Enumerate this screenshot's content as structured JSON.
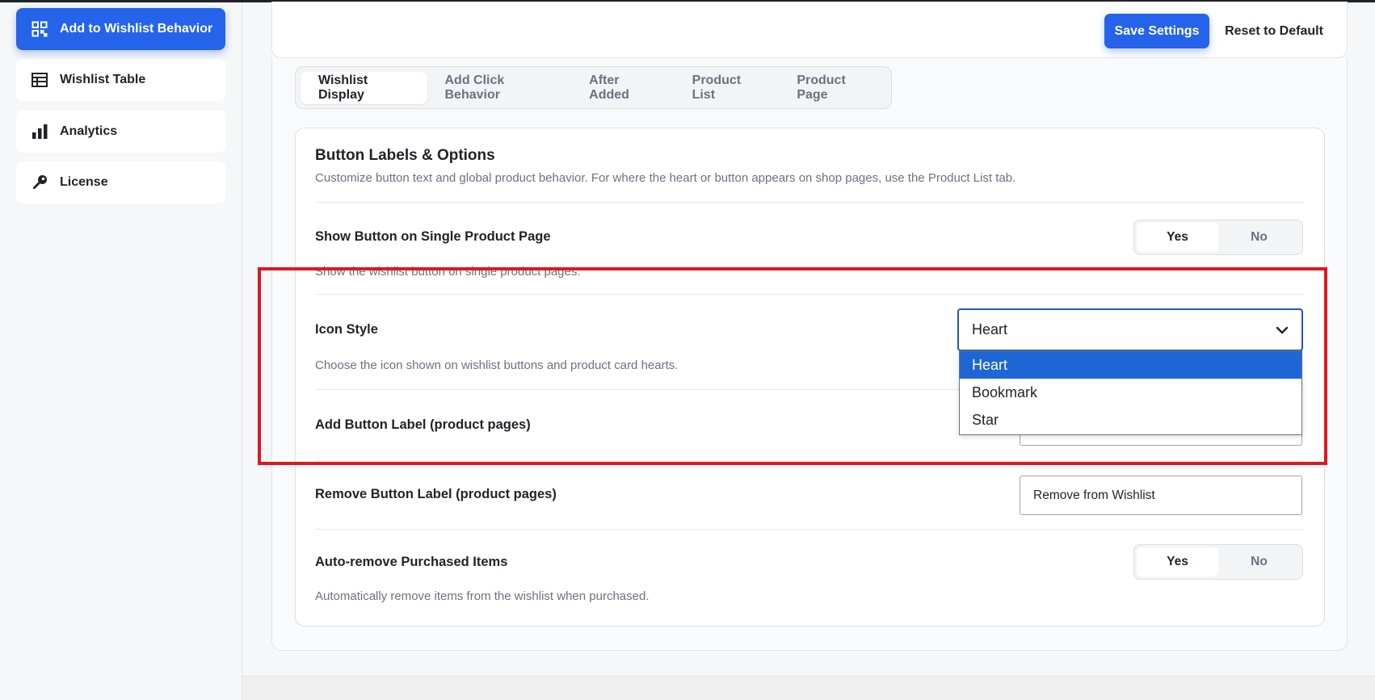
{
  "sidebar": {
    "items": [
      {
        "label": "Add to Wishlist Behavior",
        "icon": "grid-icon",
        "active": true
      },
      {
        "label": "Wishlist Table",
        "icon": "table-icon",
        "active": false
      },
      {
        "label": "Analytics",
        "icon": "bar-chart-icon",
        "active": false
      },
      {
        "label": "License",
        "icon": "key-icon",
        "active": false
      }
    ]
  },
  "header": {
    "save_label": "Save Settings",
    "reset_label": "Reset to Default"
  },
  "tabs": [
    {
      "label": "Wishlist Display",
      "active": true
    },
    {
      "label": "Add Click Behavior",
      "active": false
    },
    {
      "label": "After Added",
      "active": false
    },
    {
      "label": "Product List",
      "active": false
    },
    {
      "label": "Product Page",
      "active": false
    }
  ],
  "section": {
    "title": "Button Labels & Options",
    "description": "Customize button text and global product behavior. For where the heart or button appears on shop pages, use the Product List tab."
  },
  "settings": {
    "show_button": {
      "label": "Show Button on Single Product Page",
      "description": "Show the wishlist button on single product pages.",
      "options": [
        "Yes",
        "No"
      ],
      "selected": "Yes"
    },
    "icon_style": {
      "label": "Icon Style",
      "description": "Choose the icon shown on wishlist buttons and product card hearts.",
      "value": "Heart",
      "options": [
        "Heart",
        "Bookmark",
        "Star"
      ]
    },
    "add_label": {
      "label": "Add Button Label (product pages)",
      "value": ""
    },
    "remove_label": {
      "label": "Remove Button Label (product pages)",
      "value": "Remove from Wishlist"
    },
    "auto_remove": {
      "label": "Auto-remove Purchased Items",
      "description": "Automatically remove items from the wishlist when purchased.",
      "options": [
        "Yes",
        "No"
      ],
      "selected": "Yes"
    }
  },
  "colors": {
    "accent": "#2563eb",
    "highlight": "#e0181e",
    "dropdown_selected": "#1e66d6"
  }
}
